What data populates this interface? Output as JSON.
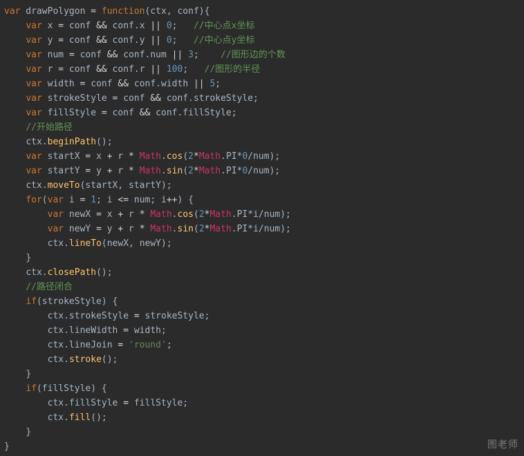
{
  "watermark": "图老师",
  "code": {
    "l1": {
      "a": "var",
      "b": " drawPolygon ",
      "c": "=",
      "d": " ",
      "e": "function",
      "f": "(ctx, conf){"
    },
    "l2": {
      "a": "var",
      "b": " x ",
      "c": "=",
      "d": " conf ",
      "e": "&&",
      "f": " conf.x ",
      "g": "||",
      "h": " ",
      "i": "0",
      "j": ";   ",
      "k": "//中心点x坐标"
    },
    "l3": {
      "a": "var",
      "b": " y ",
      "c": "=",
      "d": " conf ",
      "e": "&&",
      "f": " conf.y ",
      "g": "||",
      "h": " ",
      "i": "0",
      "j": ";   ",
      "k": "//中心点y坐标"
    },
    "l4": {
      "a": "var",
      "b": " num ",
      "c": "=",
      "d": " conf ",
      "e": "&&",
      "f": " conf.num ",
      "g": "||",
      "h": " ",
      "i": "3",
      "j": ";    ",
      "k": "//图形边的个数"
    },
    "l5": {
      "a": "var",
      "b": " r ",
      "c": "=",
      "d": " conf ",
      "e": "&&",
      "f": " conf.r ",
      "g": "||",
      "h": " ",
      "i": "100",
      "j": ";   ",
      "k": "//图形的半径"
    },
    "l6": {
      "a": "var",
      "b": " width ",
      "c": "=",
      "d": " conf ",
      "e": "&&",
      "f": " conf.width ",
      "g": "||",
      "h": " ",
      "i": "5",
      "j": ";"
    },
    "l7": {
      "a": "var",
      "b": " strokeStyle ",
      "c": "=",
      "d": " conf ",
      "e": "&&",
      "f": " conf.strokeStyle;"
    },
    "l8": {
      "a": "var",
      "b": " fillStyle ",
      "c": "=",
      "d": " conf ",
      "e": "&&",
      "f": " conf.fillStyle;"
    },
    "l9": {
      "a": "//开始路径"
    },
    "l10": {
      "a": "ctx.",
      "b": "beginPath",
      "c": "();"
    },
    "l11": {
      "a": "var",
      "b": " startX ",
      "c": "=",
      "d": " x ",
      "e": "+",
      "f": " r ",
      "g": "*",
      "h": " ",
      "i": "Math",
      "j": ".",
      "k": "cos",
      "l": "(",
      "m": "2",
      "n": "*",
      "o": "Math",
      "p": ".PI*",
      "q": "0",
      "r": "/num);"
    },
    "l12": {
      "a": "var",
      "b": " startY ",
      "c": "=",
      "d": " y ",
      "e": "+",
      "f": " r ",
      "g": "*",
      "h": " ",
      "i": "Math",
      "j": ".",
      "k": "sin",
      "l": "(",
      "m": "2",
      "n": "*",
      "o": "Math",
      "p": ".PI*",
      "q": "0",
      "r": "/num);"
    },
    "l13": {
      "a": "ctx.",
      "b": "moveTo",
      "c": "(startX, startY);"
    },
    "l14": {
      "a": "for",
      "b": "(",
      "c": "var",
      "d": " i ",
      "e": "=",
      "f": " ",
      "g": "1",
      "h": "; i ",
      "i": "<=",
      "j": " num; i",
      "k": "++",
      "l": ") {"
    },
    "l15": {
      "a": "var",
      "b": " newX ",
      "c": "=",
      "d": " x ",
      "e": "+",
      "f": " r ",
      "g": "*",
      "h": " ",
      "i": "Math",
      "j": ".",
      "k": "cos",
      "l": "(",
      "m": "2",
      "n": "*",
      "o": "Math",
      "p": ".PI*i/num);"
    },
    "l16": {
      "a": "var",
      "b": " newY ",
      "c": "=",
      "d": " y ",
      "e": "+",
      "f": " r ",
      "g": "*",
      "h": " ",
      "i": "Math",
      "j": ".",
      "k": "sin",
      "l": "(",
      "m": "2",
      "n": "*",
      "o": "Math",
      "p": ".PI*i/num);"
    },
    "l17": {
      "a": "ctx.",
      "b": "lineTo",
      "c": "(newX, newY);"
    },
    "l18": {
      "a": "}"
    },
    "l19": {
      "a": "ctx.",
      "b": "closePath",
      "c": "();"
    },
    "l20": {
      "a": "//路径闭合"
    },
    "l21": {
      "a": "if",
      "b": "(strokeStyle) {"
    },
    "l22": {
      "a": "ctx.strokeStyle ",
      "b": "=",
      "c": " strokeStyle;"
    },
    "l23": {
      "a": "ctx.lineWidth ",
      "b": "=",
      "c": " width;"
    },
    "l24": {
      "a": "ctx.lineJoin ",
      "b": "=",
      "c": " ",
      "d": "'round'",
      "e": ";"
    },
    "l25": {
      "a": "ctx.",
      "b": "stroke",
      "c": "();"
    },
    "l26": {
      "a": "}"
    },
    "l27": {
      "a": "if",
      "b": "(fillStyle) {"
    },
    "l28": {
      "a": "ctx.fillStyle ",
      "b": "=",
      "c": " fillStyle;"
    },
    "l29": {
      "a": "ctx.",
      "b": "fill",
      "c": "();"
    },
    "l30": {
      "a": "}"
    },
    "l31": {
      "a": "}"
    }
  }
}
